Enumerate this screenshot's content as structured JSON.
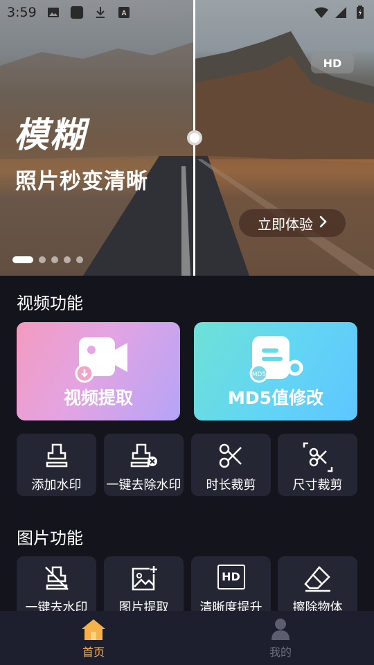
{
  "status_bar": {
    "time": "3:59"
  },
  "hero": {
    "title": "模糊",
    "subtitle": "照片秒变清晰",
    "hd_badge": "HD",
    "cta_label": "立即体验",
    "page_count": 5,
    "active_page": 1
  },
  "video_section": {
    "title": "视频功能",
    "big_cards": [
      {
        "label": "视频提取"
      },
      {
        "label": "MD5值修改"
      }
    ],
    "tools": [
      {
        "label": "添加水印"
      },
      {
        "label": "一键去除水印"
      },
      {
        "label": "时长裁剪"
      },
      {
        "label": "尺寸裁剪"
      }
    ]
  },
  "image_section": {
    "title": "图片功能",
    "tools": [
      {
        "label": "一键去水印"
      },
      {
        "label": "图片提取"
      },
      {
        "label": "清晰度提升",
        "icon_text": "HD"
      },
      {
        "label": "擦除物体"
      }
    ]
  },
  "bottom_nav": {
    "items": [
      {
        "label": "首页",
        "active": true
      },
      {
        "label": "我的",
        "active": false
      }
    ]
  },
  "colors": {
    "background": "#14141c",
    "card": "#252634",
    "nav_bg": "#1d1e2e",
    "accent": "#f6b24a",
    "inactive": "#6e7081"
  }
}
